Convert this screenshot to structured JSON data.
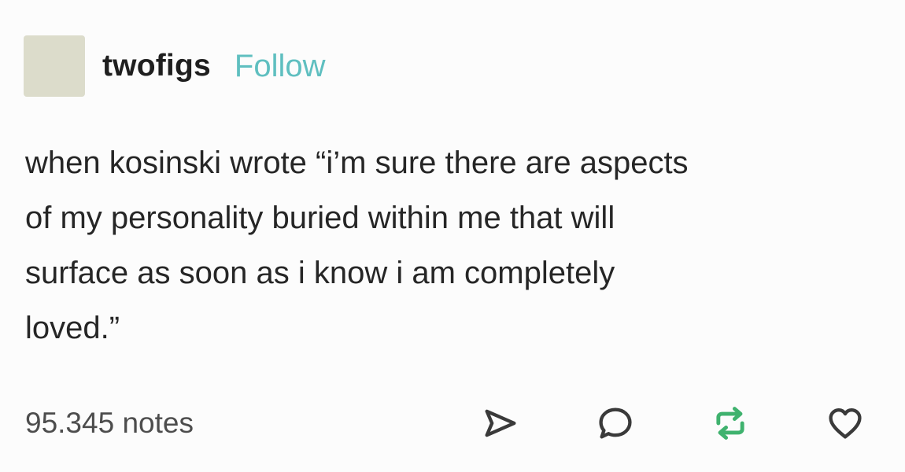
{
  "post": {
    "author": {
      "username": "twofigs",
      "follow_label": "Follow"
    },
    "body_lines": [
      "when kosinski wrote “i’m sure there are aspects",
      "of my personality buried within me that will",
      "surface as soon as i know i am completely",
      "loved.”"
    ],
    "notes_label": "95.345 notes",
    "actions": [
      {
        "icon": "share-icon"
      },
      {
        "icon": "comment-icon"
      },
      {
        "icon": "reblog-icon",
        "color": "#3fb26e"
      },
      {
        "icon": "heart-icon"
      }
    ]
  },
  "colors": {
    "follow": "#5fbfc0",
    "reblog_active": "#3fb26e",
    "avatar": "#dcdccb"
  }
}
